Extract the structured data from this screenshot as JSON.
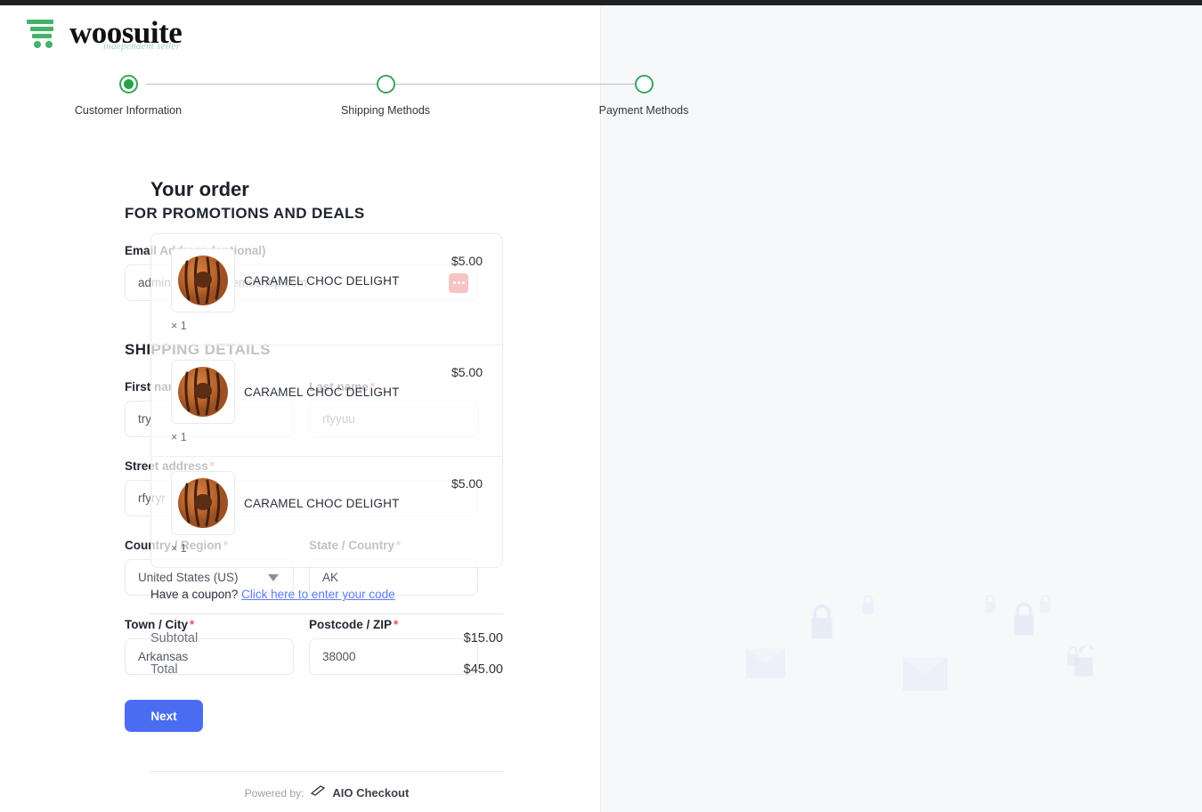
{
  "brand": {
    "name": "woosuite",
    "tagline": "independent seller",
    "cart_icon": "shopping-cart-icon",
    "accent_green": "#3aa35c"
  },
  "stepper": {
    "steps": [
      {
        "label": "Customer Information",
        "state": "active"
      },
      {
        "label": "Shipping Methods",
        "state": "upcoming"
      },
      {
        "label": "Payment Methods",
        "state": "upcoming"
      }
    ]
  },
  "promotions": {
    "heading": "FOR PROMOTIONS AND DEALS",
    "email_label": "Email Address (optional)",
    "email_value": "admin@site1.godemoshop.com",
    "password_manager_icon": "password-manager-icon"
  },
  "shipping": {
    "heading": "SHIPPING DETAILS",
    "required_mark": "*",
    "first_name_label": "First name",
    "first_name_value": "try",
    "last_name_label": "Last name",
    "last_name_value": "rtyyuu",
    "street_label": "Street address",
    "street_value": "rfyryr",
    "country_label": "Country / Region",
    "country_value": "United States (US)",
    "state_label": "State / Country",
    "state_value": "AK",
    "city_label": "Town / City",
    "city_value": "Arkansas",
    "zip_label": "Postcode / ZIP",
    "zip_value": "38000"
  },
  "actions": {
    "next_label": "Next",
    "next_color": "#4a6cf0"
  },
  "order": {
    "title": "Your order",
    "items": [
      {
        "name": "CARAMEL CHOC DELIGHT",
        "price": "$5.00",
        "qty": "× 1",
        "image": "caramel-choc-delight-thumbnail"
      },
      {
        "name": "CARAMEL CHOC DELIGHT",
        "price": "$5.00",
        "qty": "× 1",
        "image": "caramel-choc-delight-thumbnail"
      },
      {
        "name": "CARAMEL CHOC DELIGHT",
        "price": "$5.00",
        "qty": "× 1",
        "image": "caramel-choc-delight-thumbnail"
      }
    ],
    "coupon_text": "Have a coupon?",
    "coupon_link": "Click here to enter your code",
    "subtotal_label": "Subtotal",
    "subtotal_value": "$15.00",
    "total_label": "Total",
    "total_value": "$45.00"
  },
  "footer": {
    "powered_by": "Powered by:",
    "provider": "AIO Checkout",
    "provider_icon": "card-swipe-icon"
  }
}
